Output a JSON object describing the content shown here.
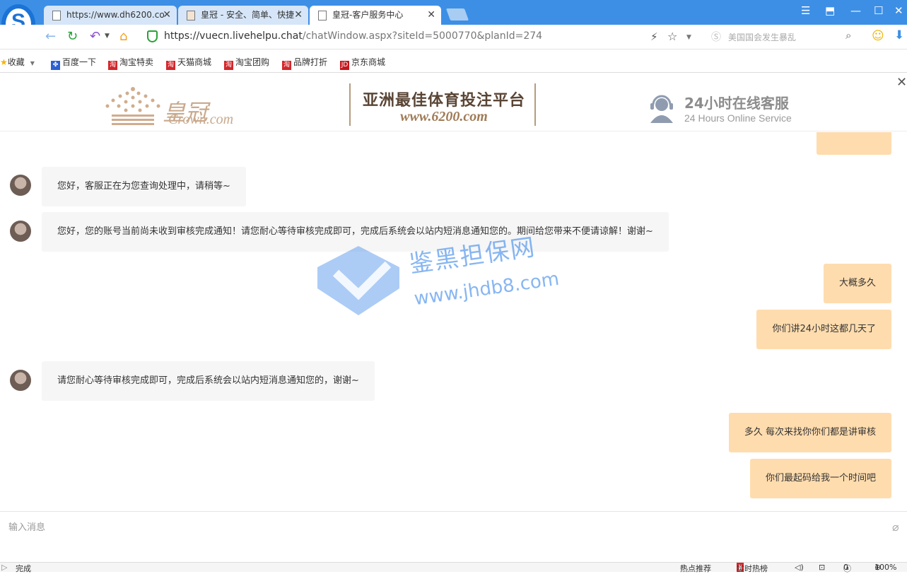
{
  "browser": {
    "logo_letter": "S",
    "tabs": [
      {
        "title": "https://www.dh6200.co"
      },
      {
        "title": "皇冠 - 安全、简单、快捷"
      },
      {
        "title": "皇冠-客户服务中心"
      }
    ],
    "url_host": "https://vuecn.livehelpu.chat",
    "url_path": "/chatWindow.aspx?siteId=5000770&planId=274",
    "search_placeholder": "美国国会发生暴乱"
  },
  "bookmarks": {
    "favorites_label": "收藏",
    "items": [
      {
        "label": "百度一下",
        "icon": "baidu-icon"
      },
      {
        "label": "淘宝特卖",
        "icon": "taobao-icon"
      },
      {
        "label": "天猫商城",
        "icon": "taobao-icon"
      },
      {
        "label": "淘宝团购",
        "icon": "taobao-icon"
      },
      {
        "label": "品牌打折",
        "icon": "taobao-icon"
      },
      {
        "label": "京东商城",
        "icon": "jd-icon"
      }
    ]
  },
  "header": {
    "brand_cn": "皇冠",
    "brand_en": "Crown.com",
    "slogan_line1": "亚洲最佳体育投注平台",
    "slogan_line2": "www.6200.com",
    "service_cn": "24小时在线客服",
    "service_en": "24 Hours Online Service"
  },
  "chat": {
    "messages": [
      {
        "from": "agent",
        "text": "您好，客服正在为您查询处理中，请稍等~"
      },
      {
        "from": "agent",
        "text": "您好，您的账号当前尚未收到审核完成通知！请您耐心等待审核完成即可，完成后系统会以站内短消息通知您的。期间给您带来不便请谅解！谢谢~"
      },
      {
        "from": "user",
        "text": "大概多久"
      },
      {
        "from": "user",
        "text": "你们讲24小时这都几天了"
      },
      {
        "from": "agent",
        "text": "请您耐心等待审核完成即可，完成后系统会以站内短消息通知您的，谢谢~"
      },
      {
        "from": "user",
        "text": "多久 每次来找你你们都是讲审核"
      },
      {
        "from": "user",
        "text": "你们最起码给我一个时间吧"
      }
    ],
    "input_placeholder": "输入消息"
  },
  "watermark": {
    "text_cn": "鉴黑担保网",
    "text_url": "www.jhdb8.com"
  },
  "statusbar": {
    "status": "完成",
    "hot_recommend": "热点推荐",
    "realtime_hot": "实时热榜",
    "ad_count": "0",
    "zoom": "100%"
  },
  "colors": {
    "titlebar": "#3d8fe6",
    "user_bubble": "#ffdcae",
    "agent_bubble": "#f6f6f6"
  }
}
